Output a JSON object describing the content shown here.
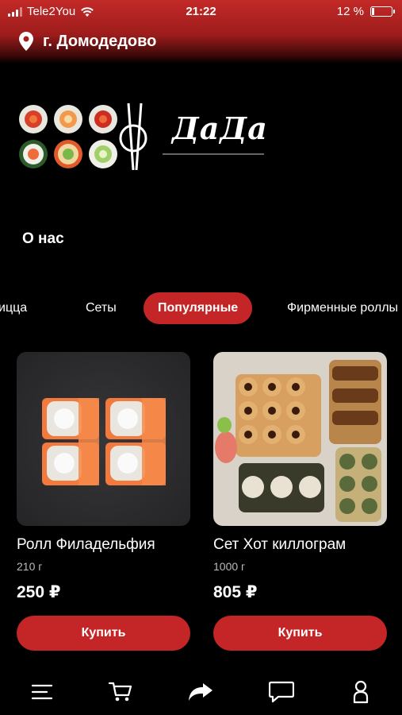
{
  "status_bar": {
    "carrier": "Tele2You",
    "time": "21:22",
    "battery_text": "12 %",
    "battery_level": 0.12
  },
  "location": {
    "city": "г. Домодедово",
    "icon": "location-pin-icon"
  },
  "brand": {
    "name": "ДаДа"
  },
  "about_link": "О нас",
  "tabs": [
    {
      "label": "иццa",
      "active": false
    },
    {
      "label": "Сеты",
      "active": false
    },
    {
      "label": "Популярные",
      "active": true
    },
    {
      "label": "Фирменные роллы",
      "active": false
    }
  ],
  "products": [
    {
      "name": "Ролл Филадельфия",
      "weight": "210 г",
      "price": "250 ₽",
      "buy_label": "Купить"
    },
    {
      "name": "Сет Хот киллограм",
      "weight": "1000 г",
      "price": "805 ₽",
      "buy_label": "Купить"
    }
  ],
  "bottom_nav": [
    {
      "icon": "menu-icon"
    },
    {
      "icon": "cart-icon"
    },
    {
      "icon": "share-icon"
    },
    {
      "icon": "chat-icon"
    },
    {
      "icon": "profile-icon"
    }
  ],
  "colors": {
    "accent": "#c42526",
    "background": "#000000",
    "header_red": "#c32a28"
  }
}
